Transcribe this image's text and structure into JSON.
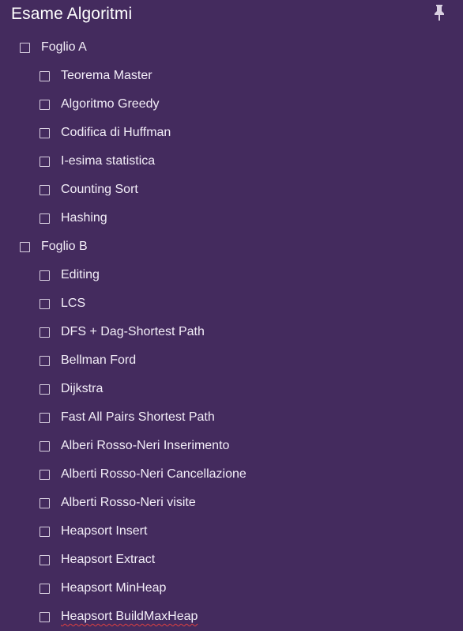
{
  "note": {
    "title": "Esame Algoritmi",
    "background_color": "#442b5e",
    "pin_icon": "pin-icon"
  },
  "items": [
    {
      "label": "Foglio A",
      "level": 1,
      "checked": false
    },
    {
      "label": "Teorema Master",
      "level": 2,
      "checked": false
    },
    {
      "label": "Algoritmo Greedy",
      "level": 2,
      "checked": false
    },
    {
      "label": "Codifica di Huffman",
      "level": 2,
      "checked": false
    },
    {
      "label": "I-esima statistica",
      "level": 2,
      "checked": false
    },
    {
      "label": "Counting Sort",
      "level": 2,
      "checked": false
    },
    {
      "label": "Hashing",
      "level": 2,
      "checked": false
    },
    {
      "label": "Foglio B",
      "level": 1,
      "checked": false
    },
    {
      "label": "Editing",
      "level": 2,
      "checked": false
    },
    {
      "label": "LCS",
      "level": 2,
      "checked": false
    },
    {
      "label": "DFS + Dag-Shortest Path",
      "level": 2,
      "checked": false
    },
    {
      "label": "Bellman Ford",
      "level": 2,
      "checked": false
    },
    {
      "label": "Dijkstra",
      "level": 2,
      "checked": false
    },
    {
      "label": "Fast All Pairs Shortest Path",
      "level": 2,
      "checked": false
    },
    {
      "label": "Alberi Rosso-Neri Inserimento",
      "level": 2,
      "checked": false
    },
    {
      "label": "Alberti Rosso-Neri Cancellazione",
      "level": 2,
      "checked": false
    },
    {
      "label": "Alberti Rosso-Neri visite",
      "level": 2,
      "checked": false
    },
    {
      "label": "Heapsort Insert",
      "level": 2,
      "checked": false
    },
    {
      "label": "Heapsort Extract",
      "level": 2,
      "checked": false
    },
    {
      "label": "Heapsort MinHeap",
      "level": 2,
      "checked": false
    },
    {
      "label": "Heapsort BuildMaxHeap",
      "level": 2,
      "checked": false,
      "spellcheck_flag": true
    }
  ]
}
